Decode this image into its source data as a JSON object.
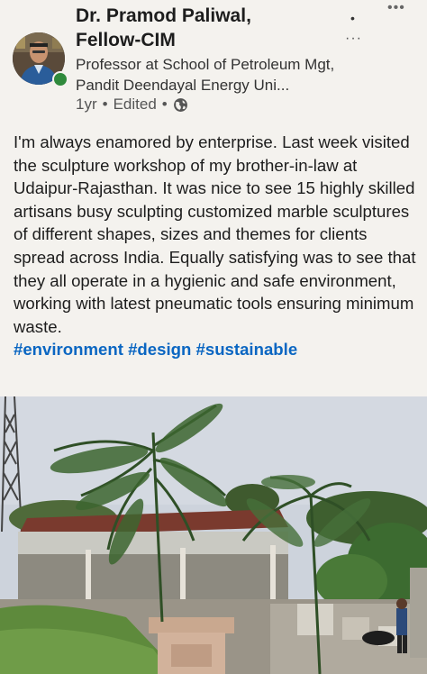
{
  "author": {
    "name_line1": "Dr. Pramod Paliwal,",
    "name_line2": "Fellow-CIM",
    "headline": "Professor at School of Petroleum Mgt, Pandit Deendayal Energy Uni...",
    "time": "1yr",
    "edited": "Edited",
    "separator": "•",
    "online_color": "#2f8a3c"
  },
  "controls": {
    "degree_dot": "•",
    "more_top": "•••",
    "more_menu": "···"
  },
  "post": {
    "text": "I'm always enamored by enterprise. Last week visited the sculpture workshop of my brother-in-law at Udaipur-Rajasthan. It was nice to see 15 highly skilled artisans busy sculpting customized marble sculptures of different shapes, sizes and themes for clients spread across India. Equally satisfying was to see that they all operate in a hygienic and safe environment, working with latest pneumatic tools ensuring minimum waste.",
    "hashtags": "#environment #design #sustainable",
    "hashtag_color": "#0a66c2"
  },
  "icons": {
    "globe": "globe-icon",
    "avatar": "avatar"
  }
}
